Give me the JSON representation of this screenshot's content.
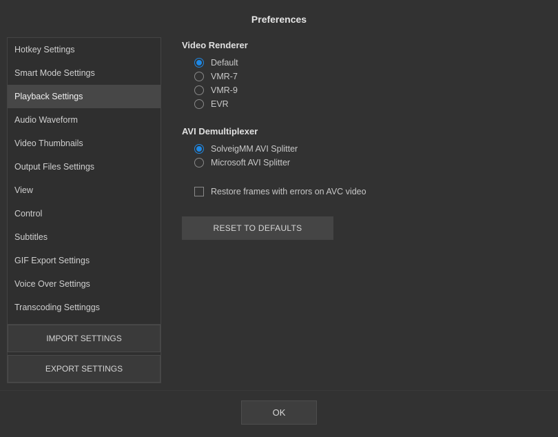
{
  "title": "Preferences",
  "sidebar": {
    "items": [
      {
        "label": "Hotkey Settings",
        "selected": false
      },
      {
        "label": "Smart Mode Settings",
        "selected": false
      },
      {
        "label": "Playback Settings",
        "selected": true
      },
      {
        "label": "Audio Waveform",
        "selected": false
      },
      {
        "label": "Video Thumbnails",
        "selected": false
      },
      {
        "label": "Output Files Settings",
        "selected": false
      },
      {
        "label": "View",
        "selected": false
      },
      {
        "label": "Control",
        "selected": false
      },
      {
        "label": "Subtitles",
        "selected": false
      },
      {
        "label": "GIF Export Settings",
        "selected": false
      },
      {
        "label": "Voice Over Settings",
        "selected": false
      },
      {
        "label": "Transcoding Settinggs",
        "selected": false
      }
    ],
    "import_label": "IMPORT SETTINGS",
    "export_label": "EXPORT SETTINGS"
  },
  "content": {
    "video_renderer": {
      "title": "Video Renderer",
      "options": [
        {
          "label": "Default",
          "checked": true
        },
        {
          "label": "VMR-7",
          "checked": false
        },
        {
          "label": "VMR-9",
          "checked": false
        },
        {
          "label": "EVR",
          "checked": false
        }
      ]
    },
    "avi_demux": {
      "title": "AVI Demultiplexer",
      "options": [
        {
          "label": "SolveigMM AVI Splitter",
          "checked": true
        },
        {
          "label": "Microsoft AVI Splitter",
          "checked": false
        }
      ]
    },
    "restore_frames": {
      "label": "Restore frames with errors on AVC video",
      "checked": false
    },
    "reset_label": "RESET TO DEFAULTS"
  },
  "footer": {
    "ok_label": "OK"
  }
}
